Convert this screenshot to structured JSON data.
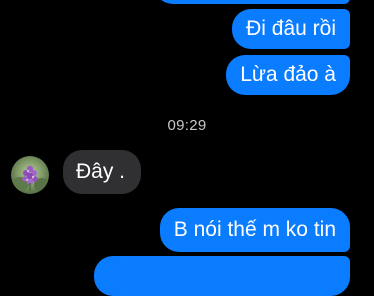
{
  "messages": {
    "outgoing_1": "Đi đâu rồi",
    "outgoing_2": "Lừa đảo à",
    "timestamp": "09:29",
    "incoming_1": "Đây .",
    "outgoing_3": "B nói thế m ko tin"
  },
  "colors": {
    "outgoing_bubble": "#0a7cff",
    "incoming_bubble": "#303033",
    "background": "#000000",
    "timestamp_text": "#c8c8cc"
  },
  "icons": {
    "avatar": "contact-avatar-flowers"
  }
}
